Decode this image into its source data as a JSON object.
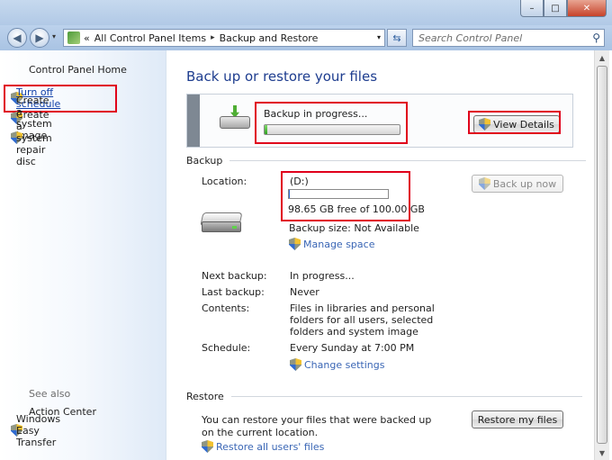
{
  "window": {
    "minimize_glyph": "–",
    "maximize_glyph": "□",
    "close_glyph": "✕"
  },
  "nav": {
    "back_glyph": "◀",
    "forward_glyph": "▶",
    "dropdown_glyph": "▾",
    "breadcrumb_prefix": "«",
    "breadcrumb": [
      "All Control Panel Items",
      "Backup and Restore"
    ],
    "breadcrumb_sep": "▸",
    "refresh_glyph": "⇆",
    "search_placeholder": "Search Control Panel",
    "search_glyph": "⚲"
  },
  "sidebar": {
    "home": "Control Panel Home",
    "items": [
      {
        "label": "Turn off schedule",
        "icon": "shield-icon"
      },
      {
        "label": "Create a system image",
        "icon": "shield-icon"
      },
      {
        "label": "Create a system repair disc",
        "icon": "shield-icon"
      }
    ],
    "see_also": "See also",
    "see_also_items": [
      {
        "label": "Action Center"
      },
      {
        "label": "Windows Easy Transfer",
        "icon": "shield-icon"
      }
    ]
  },
  "main": {
    "help_glyph": "?",
    "title": "Back up or restore your files",
    "progress": {
      "label": "Backup in progress...",
      "fraction": 0.02,
      "view_details": "View Details"
    },
    "backup": {
      "heading": "Backup",
      "location_label": "Location:",
      "location_value": "(D:)",
      "space_used_fraction": 0.0135,
      "free_space": "98.65 GB free of 100.00 GB",
      "backup_size": "Backup size: Not Available",
      "manage_space": "Manage space",
      "back_up_now": "Back up now",
      "next_backup_label": "Next backup:",
      "next_backup_value": "In progress...",
      "last_backup_label": "Last backup:",
      "last_backup_value": "Never",
      "contents_label": "Contents:",
      "contents_value": "Files in libraries and personal folders for all users, selected folders and system image",
      "schedule_label": "Schedule:",
      "schedule_value": "Every Sunday at 7:00 PM",
      "change_settings": "Change settings"
    },
    "restore": {
      "heading": "Restore",
      "text": "You can restore your files that were backed up on the current location.",
      "restore_my_files": "Restore my files",
      "restore_all_users": "Restore all users' files"
    }
  },
  "scrollbar": {
    "up_glyph": "▲",
    "down_glyph": "▼"
  },
  "colors": {
    "highlight": "#e0001b",
    "link": "#0f3fa8",
    "title": "#1e3d8f",
    "progress_fill": "#2fa11f",
    "capacity_fill": "#2f6bd1"
  }
}
